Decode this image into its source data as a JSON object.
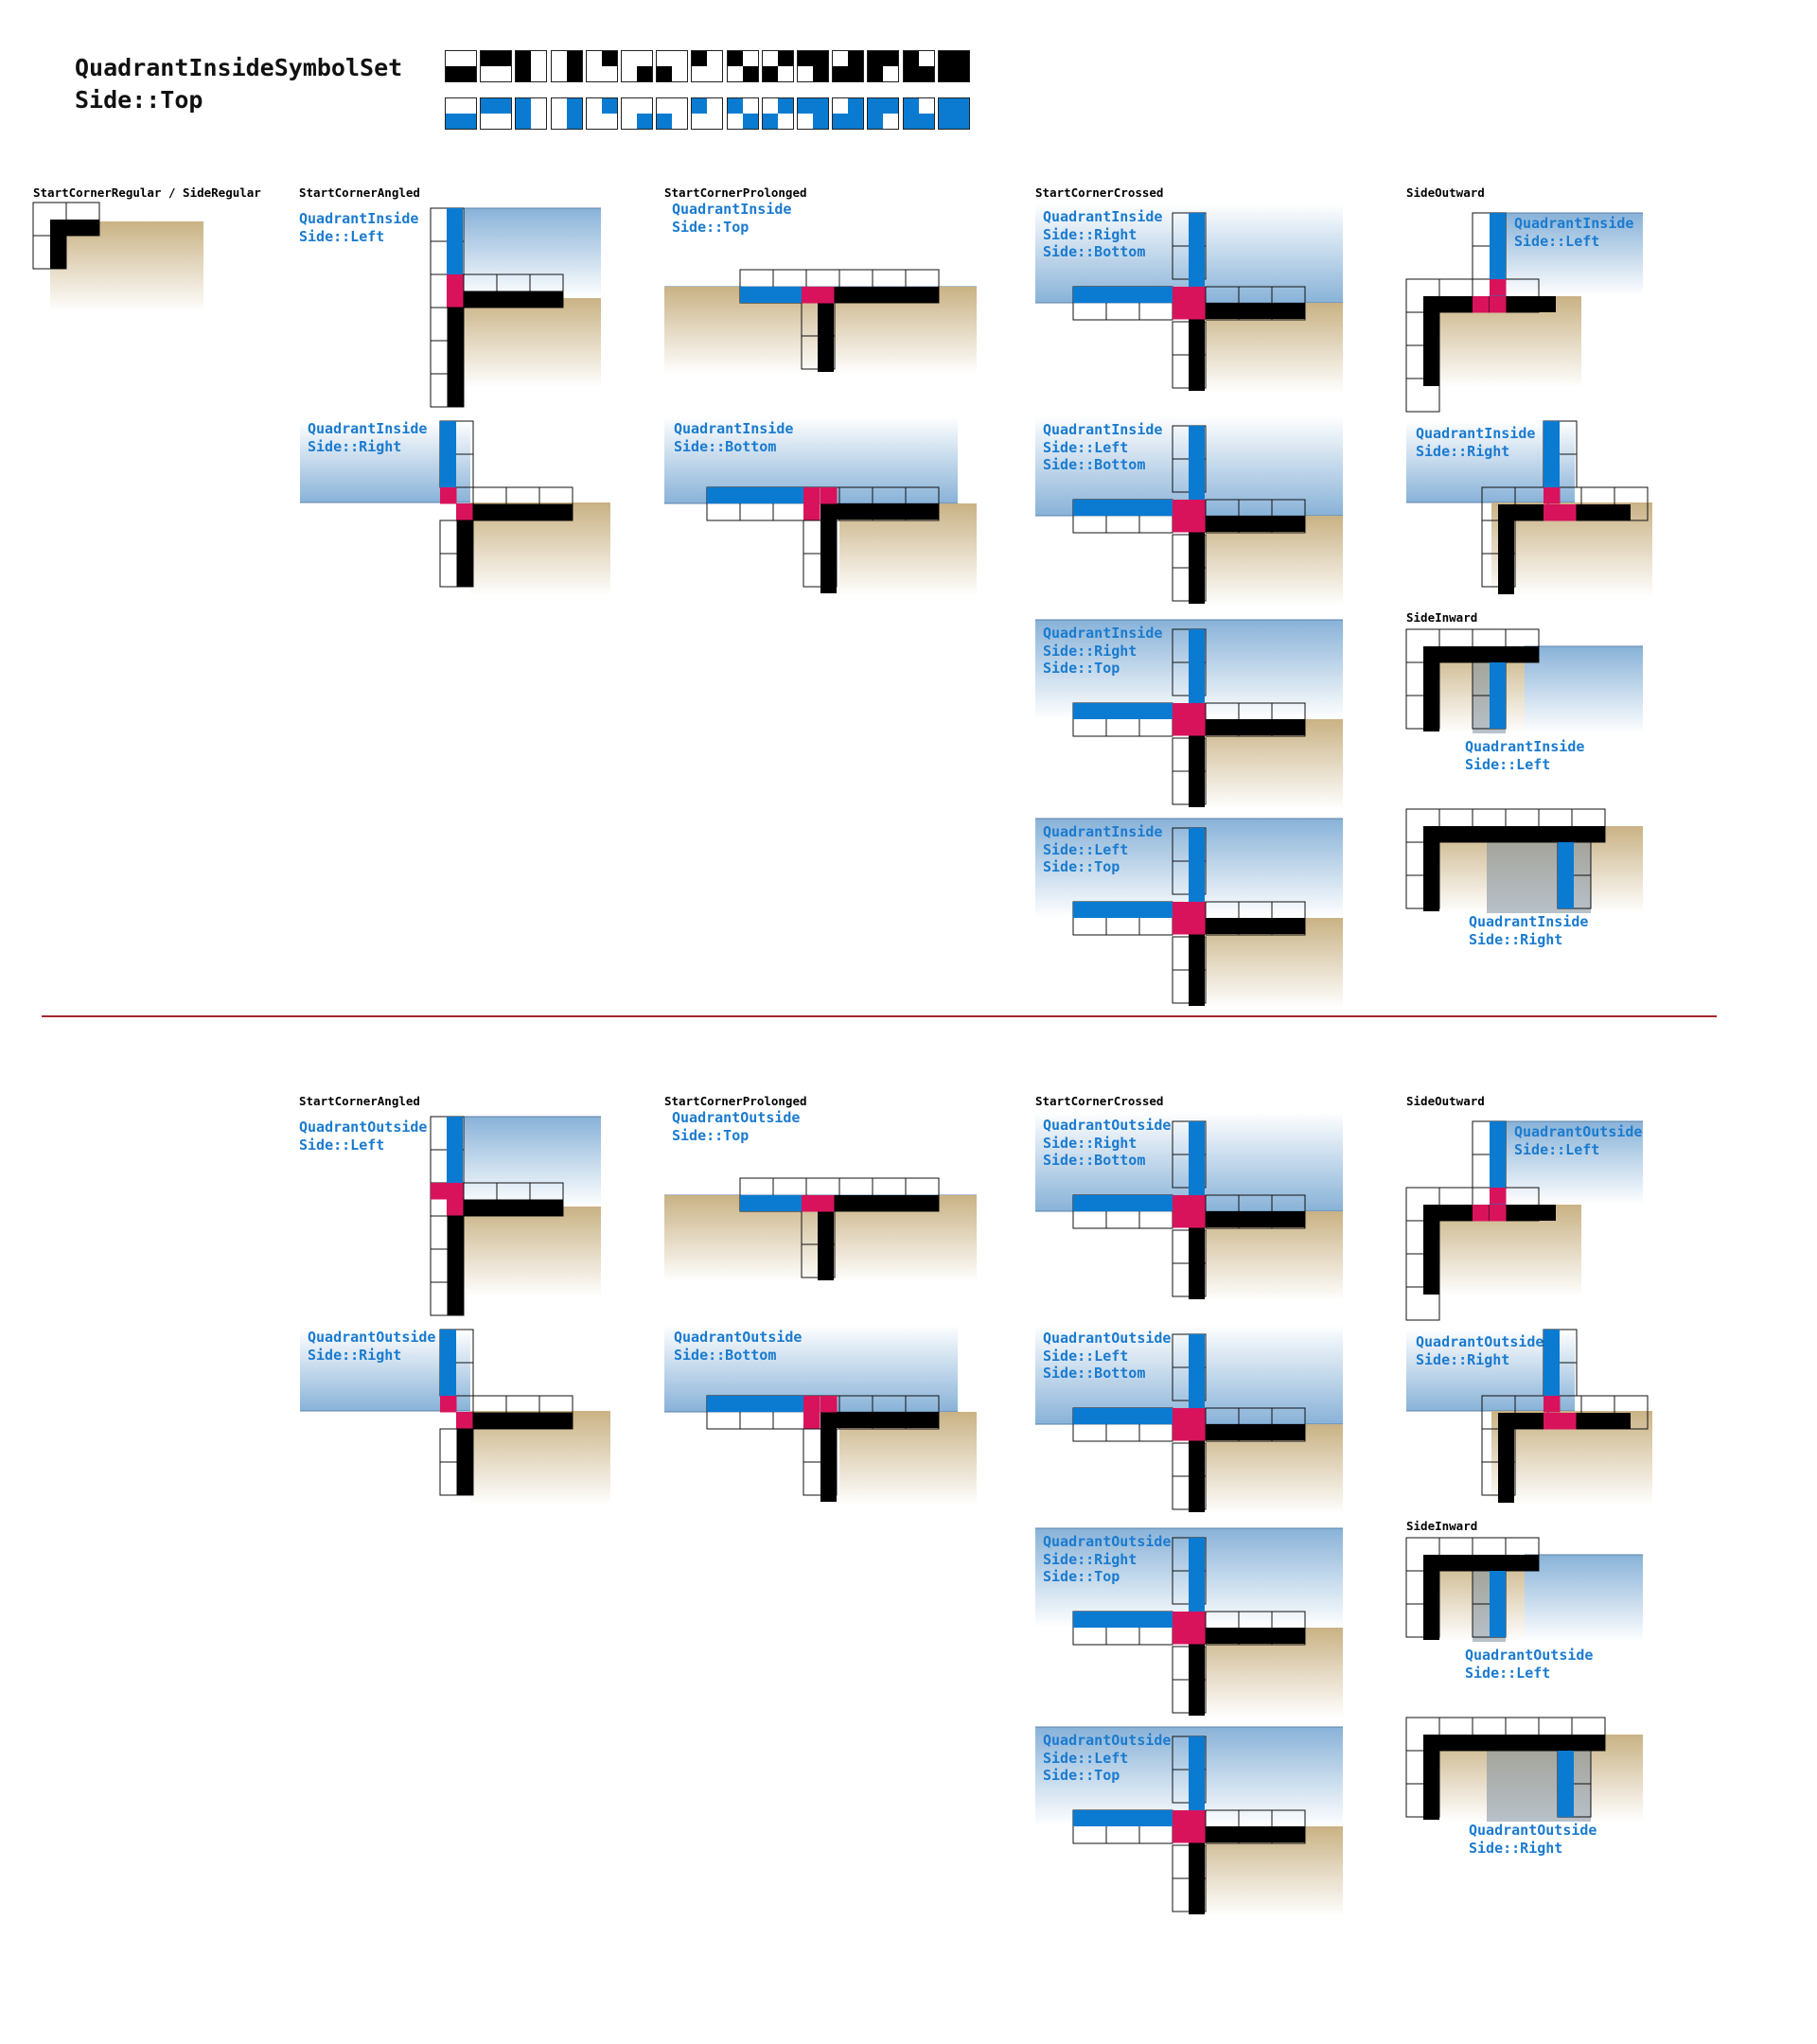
{
  "title": [
    "QuadrantInsideSymbolSet",
    "Side::Top"
  ],
  "colors": {
    "black": "#000000",
    "blue": "#0a7bd1",
    "magenta": "#d8135c",
    "divider": "#a3282d",
    "label": "#1a7bcf"
  },
  "symbol_row_black": [
    "lower-half",
    "upper-half",
    "left-half",
    "right-half",
    "upper-right-quadrant",
    "lower-right-quadrant",
    "lower-left-quadrant",
    "upper-left-quadrant",
    "diagonal-ul-lr",
    "diagonal-ur-ll",
    "three-quadrants-missing-lower-left",
    "three-quadrants-missing-upper-left",
    "three-quadrants-missing-lower-right",
    "three-quadrants-missing-upper-right",
    "full-block"
  ],
  "symbol_row_blue": [
    "lower-half",
    "upper-half",
    "left-half",
    "right-half",
    "upper-right-quadrant",
    "lower-right-quadrant",
    "lower-left-quadrant",
    "upper-left-quadrant",
    "diagonal-ul-lr",
    "diagonal-ur-ll",
    "three-quadrants-missing-lower-left",
    "three-quadrants-missing-upper-left",
    "three-quadrants-missing-lower-right",
    "three-quadrants-missing-upper-right",
    "full-block"
  ],
  "column_headers": {
    "regular": "StartCornerRegular / SideRegular",
    "angled": "StartCornerAngled",
    "prolonged": "StartCornerProlonged",
    "crossed": "StartCornerCrossed",
    "outward": "SideOutward",
    "inward": "SideInward"
  },
  "sections": [
    {
      "id": "inside",
      "panels": [
        {
          "column": "angled",
          "label": [
            "QuadrantInside",
            "Side::Left"
          ]
        },
        {
          "column": "angled",
          "label": [
            "QuadrantInside",
            "Side::Right"
          ]
        },
        {
          "column": "prolonged",
          "label": [
            "QuadrantInside",
            "Side::Top"
          ]
        },
        {
          "column": "prolonged",
          "label": [
            "QuadrantInside",
            "Side::Bottom"
          ]
        },
        {
          "column": "crossed",
          "label": [
            "QuadrantInside",
            "Side::Right",
            "Side::Bottom"
          ]
        },
        {
          "column": "crossed",
          "label": [
            "QuadrantInside",
            "Side::Left",
            "Side::Bottom"
          ]
        },
        {
          "column": "crossed",
          "label": [
            "QuadrantInside",
            "Side::Right",
            "Side::Top"
          ]
        },
        {
          "column": "crossed",
          "label": [
            "QuadrantInside",
            "Side::Left",
            "Side::Top"
          ]
        },
        {
          "column": "outward",
          "label": [
            "QuadrantInside",
            "Side::Left"
          ]
        },
        {
          "column": "outward",
          "label": [
            "QuadrantInside",
            "Side::Right"
          ]
        },
        {
          "column": "inward",
          "label": [
            "QuadrantInside",
            "Side::Left"
          ]
        },
        {
          "column": "inward",
          "label": [
            "QuadrantInside",
            "Side::Right"
          ]
        }
      ]
    },
    {
      "id": "outside",
      "panels": [
        {
          "column": "angled",
          "label": [
            "QuadrantOutside",
            "Side::Left"
          ]
        },
        {
          "column": "angled",
          "label": [
            "QuadrantOutside",
            "Side::Right"
          ]
        },
        {
          "column": "prolonged",
          "label": [
            "QuadrantOutside",
            "Side::Top"
          ]
        },
        {
          "column": "prolonged",
          "label": [
            "QuadrantOutside",
            "Side::Bottom"
          ]
        },
        {
          "column": "crossed",
          "label": [
            "QuadrantOutside",
            "Side::Right",
            "Side::Bottom"
          ]
        },
        {
          "column": "crossed",
          "label": [
            "QuadrantOutside",
            "Side::Left",
            "Side::Bottom"
          ]
        },
        {
          "column": "crossed",
          "label": [
            "QuadrantOutside",
            "Side::Right",
            "Side::Top"
          ]
        },
        {
          "column": "crossed",
          "label": [
            "QuadrantOutside",
            "Side::Left",
            "Side::Top"
          ]
        },
        {
          "column": "outward",
          "label": [
            "QuadrantOutside",
            "Side::Left"
          ]
        },
        {
          "column": "outward",
          "label": [
            "QuadrantOutside",
            "Side::Right"
          ]
        },
        {
          "column": "inward",
          "label": [
            "QuadrantOutside",
            "Side::Left"
          ]
        },
        {
          "column": "inward",
          "label": [
            "QuadrantOutside",
            "Side::Right"
          ]
        }
      ]
    }
  ]
}
